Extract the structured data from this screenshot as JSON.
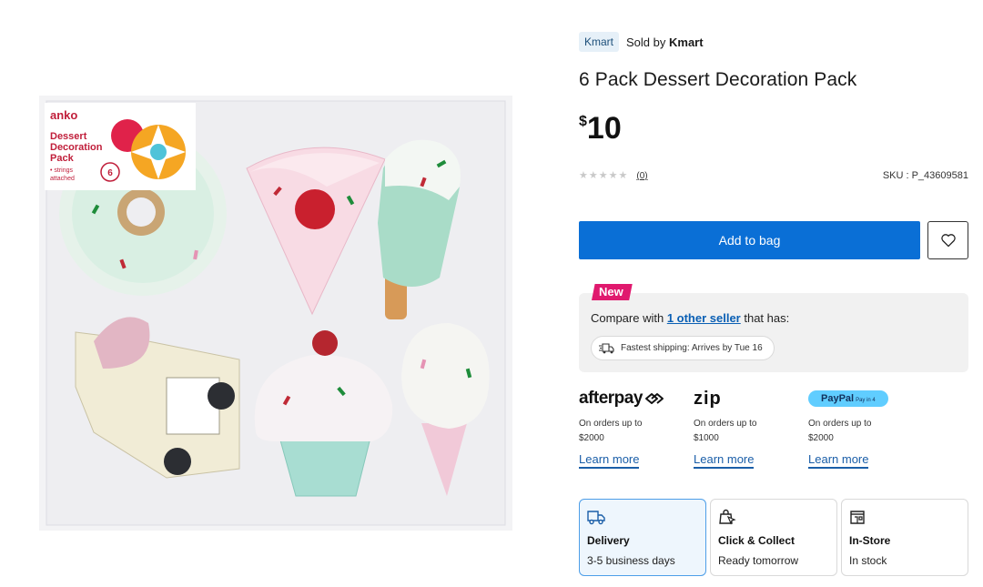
{
  "product_image": {
    "brand": "anko",
    "box_title": "Dessert Decoration Pack",
    "box_title_lines": [
      "Dessert",
      "Decoration",
      "Pack"
    ],
    "box_subtitle_lines": [
      "• strings",
      "attached"
    ],
    "box_count": "6"
  },
  "seller": {
    "badge": "Kmart",
    "sold_by_prefix": "Sold by ",
    "sold_by_name": "Kmart"
  },
  "product": {
    "title": "6 Pack Dessert Decoration Pack",
    "price_currency": "$",
    "price_amount": "10",
    "rating_stars": "★★★★★",
    "rating_value": 0,
    "review_count": "(0)",
    "sku": "SKU : P_43609581"
  },
  "actions": {
    "add_to_bag": "Add to bag",
    "wishlist_icon": "heart-icon"
  },
  "compare": {
    "new_label": "New",
    "text_before": "Compare with ",
    "link_text": "1 other seller",
    "text_after": " that has:",
    "shipping_chip": "Fastest shipping: Arrives by Tue 16"
  },
  "payments": [
    {
      "name": "afterpay",
      "logo_text": "afterpay",
      "desc_line1": "On orders up to",
      "desc_line2": "$2000",
      "learn": "Learn more"
    },
    {
      "name": "zip",
      "logo_text": "zip",
      "desc_line1": "On orders up to",
      "desc_line2": "$1000",
      "learn": "Learn more"
    },
    {
      "name": "paypal",
      "logo_text": "PayPal",
      "logo_suffix": "Pay in 4",
      "desc_line1": "On orders up to",
      "desc_line2": "$2000",
      "learn": "Learn more"
    }
  ],
  "fulfilment": [
    {
      "title": "Delivery",
      "sub": "3-5 business days",
      "icon": "truck-icon",
      "selected": true
    },
    {
      "title": "Click & Collect",
      "sub": "Ready tomorrow",
      "icon": "bag-cursor-icon",
      "selected": false
    },
    {
      "title": "In-Store",
      "sub": "In stock",
      "icon": "store-icon",
      "selected": false
    }
  ],
  "colors": {
    "primary_blue": "#0a6fd6",
    "new_tag_pink": "#e0196e",
    "link_blue": "#1a5ea8",
    "paypal_bg": "#60cdff"
  }
}
